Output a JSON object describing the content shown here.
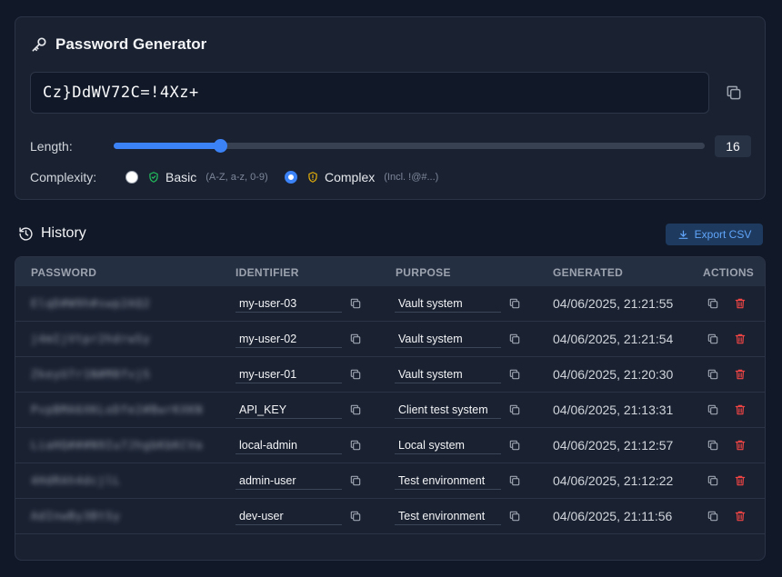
{
  "generator": {
    "title": "Password Generator",
    "password": "Cz}DdWV72C=!4Xz+",
    "length_label": "Length:",
    "length_value": "16",
    "length_fraction": 0.18,
    "complexity_label": "Complexity:",
    "options": [
      {
        "label": "Basic",
        "hint": "(A-Z, a-z, 0-9)",
        "checked": false,
        "icon_color": "#22c55e"
      },
      {
        "label": "Complex",
        "hint": "(Incl. !@#...)",
        "checked": true,
        "icon_color": "#eab308"
      }
    ]
  },
  "history": {
    "title": "History",
    "export_label": "Export CSV",
    "columns": [
      "PASSWORD",
      "IDENTIFIER",
      "PURPOSE",
      "GENERATED",
      "ACTIONS"
    ],
    "rows": [
      {
        "password": "ElqD#W9h#swp2AQ2",
        "identifier": "my-user-03",
        "purpose": "Vault system",
        "generated": "04/06/2025, 21:21:55"
      },
      {
        "password": "j4mIjVtpr2hdrwSy",
        "identifier": "my-user-02",
        "purpose": "Vault system",
        "generated": "04/06/2025, 21:21:54"
      },
      {
        "password": "ZkeyU7r1N#M8fvjS",
        "identifier": "my-user-01",
        "purpose": "Vault system",
        "generated": "04/06/2025, 21:20:30"
      },
      {
        "password": "PvpBMA6XKLoDfe2#BwrKXKN",
        "identifier": "API_KEY",
        "purpose": "Client test system",
        "generated": "04/06/2025, 21:13:31"
      },
      {
        "password": "LiaHQ###N9Iu7JhgbKbKCVa",
        "identifier": "local-admin",
        "purpose": "Local system",
        "generated": "04/06/2025, 21:12:57"
      },
      {
        "password": "4HdRAh4dcjlL",
        "identifier": "admin-user",
        "purpose": "Test environment",
        "generated": "04/06/2025, 21:12:22"
      },
      {
        "password": "AdInwBy3BtSy",
        "identifier": "dev-user",
        "purpose": "Test environment",
        "generated": "04/06/2025, 21:11:56"
      }
    ]
  },
  "colors": {
    "accent": "#3b82f6",
    "delete": "#ef4444",
    "background": "#111827",
    "panel": "#1a2232"
  }
}
